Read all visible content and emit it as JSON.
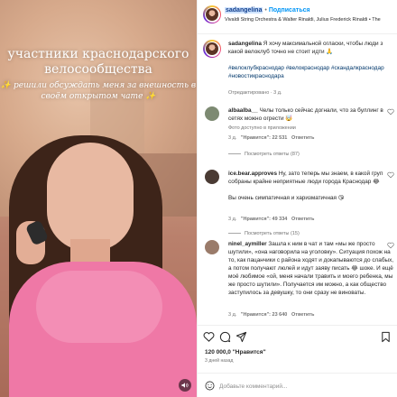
{
  "video": {
    "caption_line1": "участники краснодарского велосообщества",
    "caption_line2": "✨ решили обсуждать меня за внешность в своём открытом чате ✨"
  },
  "post": {
    "username": "sadangelina",
    "separator": "•",
    "follow_label": "Подписаться",
    "music": "Vivaldi String Orchestra & Walter Rinaldi, Julius Frederick Rinaldi • The"
  },
  "caption": {
    "username": "sadangelina",
    "text": "Я хочу максимальной огласки, чтобы люди з какой велоклуб точно не стоит идти",
    "emoji": "🙏",
    "hashtags": "#велоклубкраснодар #велокраснодар #скандалкраснодар #новостикраснодара",
    "edited": "Отредактировано · 3 д."
  },
  "comments": [
    {
      "username": "albaalba__",
      "text": "Челы только сейчас догнали, что за буллинг в сетях можно огрести",
      "emoji": "🤯",
      "translate": "Фото доступно в приложении",
      "age": "3 д.",
      "likes": "\"Нравится\": 22 531",
      "reply": "Ответить",
      "replies": "Посмотреть ответы (87)"
    },
    {
      "username": "ice.bear.approves",
      "text": "Ну, зато теперь мы знаем, в какой груп собраны крайне неприятные люди города Краснодар",
      "emoji": "😂",
      "text2": "Вы очень симпатичная и харизматичная",
      "emoji2": "😘",
      "age": "3 д.",
      "likes": "\"Нравится\": 49 334",
      "reply": "Ответить",
      "replies": "Посмотреть ответы (15)"
    },
    {
      "username": "ninel_aymiller",
      "text": "Зашла к ним в чат и там «мы же просто шутили», «она наговорила на уголовку». Ситуация похож на то, как пацанчики с района ходят и докапываются до слабых, а потом получают люлей и идут заяву писать",
      "emoji": "😂",
      "text_b": "шоке. И ещё моё любимое «ой, меня начали травить и моего ребенка, мы же просто шутили». Получается им можно, а как общество заступилось за девушку, то они сразу не виноваты.",
      "age": "3 д.",
      "likes": "\"Нравится\": 23 640",
      "reply": "Ответить"
    }
  ],
  "actions": {
    "likes": "120 000,0 \"Нравится\"",
    "posted": "3 дней назад",
    "comment_placeholder": "Добавьте комментарий..."
  },
  "colors": {
    "link": "#0095f6",
    "hashtag": "#00376b",
    "video_top": "#ef78a6"
  }
}
